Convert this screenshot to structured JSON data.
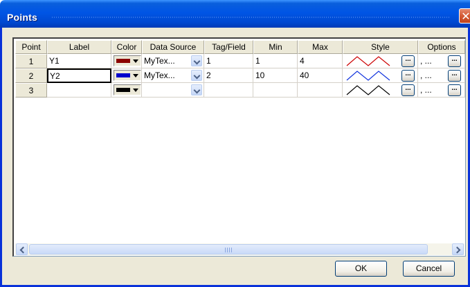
{
  "window": {
    "title": "Points"
  },
  "icons": {
    "close": "close-icon",
    "dropdown": "chevron-down-icon",
    "ellipsis": "ellipsis-icon",
    "scroll_left": "arrow-left-icon",
    "scroll_right": "arrow-right-icon"
  },
  "columns": [
    "Point",
    "Label",
    "Color",
    "Data Source",
    "Tag/Field",
    "Min",
    "Max",
    "Style",
    "Options"
  ],
  "rows": [
    {
      "point": "1",
      "label": "Y1",
      "color": "#8b0000",
      "source": "MyTex...",
      "tag": "1",
      "min": "1",
      "max": "4",
      "style_color": "#cc0000",
      "options": ", ...",
      "ellipsis": "..."
    },
    {
      "point": "2",
      "label": "Y2",
      "color": "#0000cc",
      "source": "MyTex...",
      "tag": "2",
      "min": "10",
      "max": "40",
      "style_color": "#1133dd",
      "options": ", ...",
      "ellipsis": "..."
    },
    {
      "point": "3",
      "label": "",
      "color": "#000000",
      "source": "",
      "tag": "",
      "min": "",
      "max": "",
      "style_color": "#000000",
      "options": ", ...",
      "ellipsis": "..."
    }
  ],
  "buttons": {
    "ok": "OK",
    "cancel": "Cancel"
  },
  "close_glyph": "✕"
}
